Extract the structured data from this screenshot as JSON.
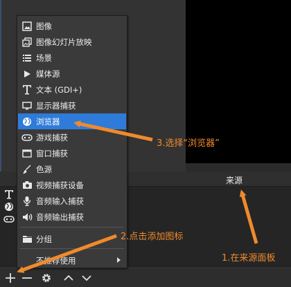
{
  "menu": {
    "items": [
      {
        "label": "图像",
        "icon": "image-icon"
      },
      {
        "label": "图像幻灯片放映",
        "icon": "slideshow-icon"
      },
      {
        "label": "场景",
        "icon": "scene-list-icon"
      },
      {
        "label": "媒体源",
        "icon": "play-icon"
      },
      {
        "label": "文本 (GDI+)",
        "icon": "text-icon"
      },
      {
        "label": "显示器捕获",
        "icon": "monitor-icon"
      },
      {
        "label": "浏览器",
        "icon": "globe-icon",
        "selected": true
      },
      {
        "label": "游戏捕获",
        "icon": "gamepad-icon"
      },
      {
        "label": "窗口捕获",
        "icon": "window-icon"
      },
      {
        "label": "色源",
        "icon": "brush-icon"
      },
      {
        "label": "视频捕获设备",
        "icon": "camera-icon"
      },
      {
        "label": "音频输入捕获",
        "icon": "microphone-icon"
      },
      {
        "label": "音频输出捕获",
        "icon": "speaker-icon"
      }
    ],
    "group_label": "分组",
    "deprecated_label": "不推荐使用"
  },
  "sources_panel": {
    "title": "来源"
  },
  "annotations": {
    "step1": "1.在来源面板",
    "step2": "2.点击添加图标",
    "step3": "3.选择“浏览器”"
  },
  "colors": {
    "annotation": "#f08a2c",
    "selection": "#2f7bd9"
  }
}
